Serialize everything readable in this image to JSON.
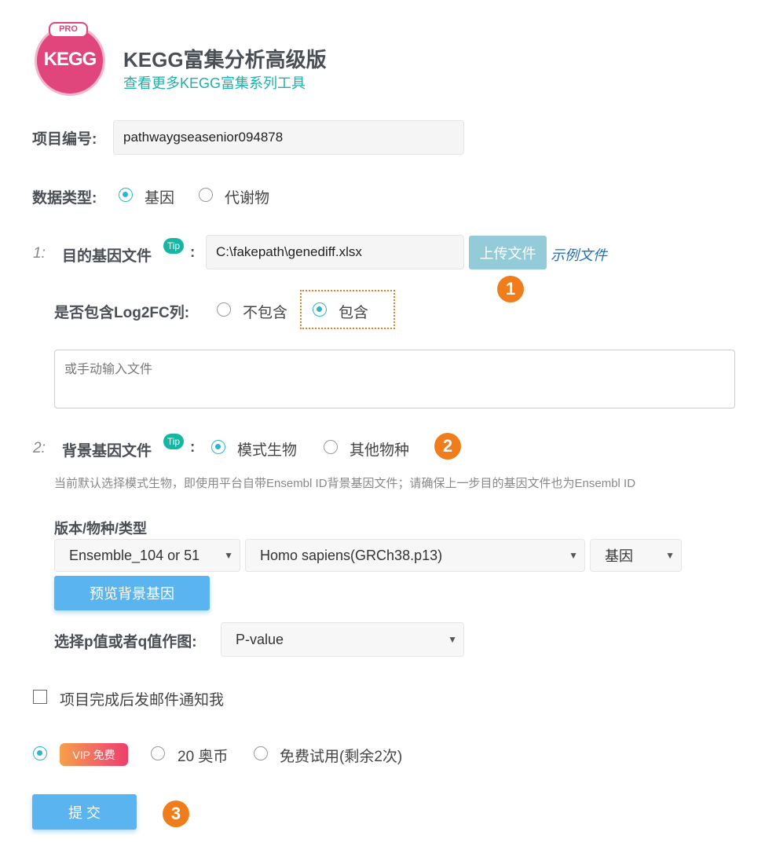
{
  "header": {
    "logo_badge": "PRO",
    "logo_text": "KEGG",
    "title": "KEGG富集分析高级版",
    "subtitle_link": "查看更多KEGG富集系列工具"
  },
  "project": {
    "label": "项目编号:",
    "value": "pathwaygseasenior094878"
  },
  "data_type": {
    "label": "数据类型:",
    "options": [
      "基因",
      "代谢物"
    ],
    "selected": "基因"
  },
  "step1": {
    "number": "1:",
    "label": "目的基因文件",
    "tip": "Tip",
    "colon": ":",
    "file_value": "C:\\fakepath\\genediff.xlsx",
    "upload_button": "上传文件",
    "example_link": "示例文件",
    "log2fc_label": "是否包含Log2FC列:",
    "log2fc_options": [
      "不包含",
      "包含"
    ],
    "log2fc_selected": "包含",
    "textarea_placeholder": "或手动输入文件"
  },
  "step2": {
    "number": "2:",
    "label": "背景基因文件",
    "tip": "Tip",
    "colon": ":",
    "options": [
      "模式生物",
      "其他物种"
    ],
    "selected": "模式生物",
    "note": "当前默认选择模式生物，即使用平台自带Ensembl ID背景基因文件；请确保上一步目的基因文件也为Ensembl ID",
    "version_label": "版本/物种/类型",
    "version_select": "Ensemble_104 or 51",
    "species_select": "Homo sapiens(GRCh38.p13)",
    "type_select": "基因",
    "preview_button": "预览背景基因",
    "pq_label": "选择p值或者q值作图:",
    "pq_select": "P-value"
  },
  "notify": {
    "label": "项目完成后发邮件通知我",
    "checked": false
  },
  "payment": {
    "vip_badge": "VIP 免费",
    "options": [
      "20 奥币",
      "免费试用(剩余2次)"
    ],
    "selected": "VIP 免费"
  },
  "submit_button": "提 交",
  "step_badges": [
    "1",
    "2",
    "3"
  ],
  "colors": {
    "accent_teal": "#2db5c9",
    "step_orange": "#f07d1b",
    "button_blue": "#5ab4ef",
    "upload_button": "#93ccd8",
    "logo_pink": "#e0457b"
  },
  "icons": [
    "logo-icon",
    "tip-icon",
    "caret-down-icon"
  ]
}
